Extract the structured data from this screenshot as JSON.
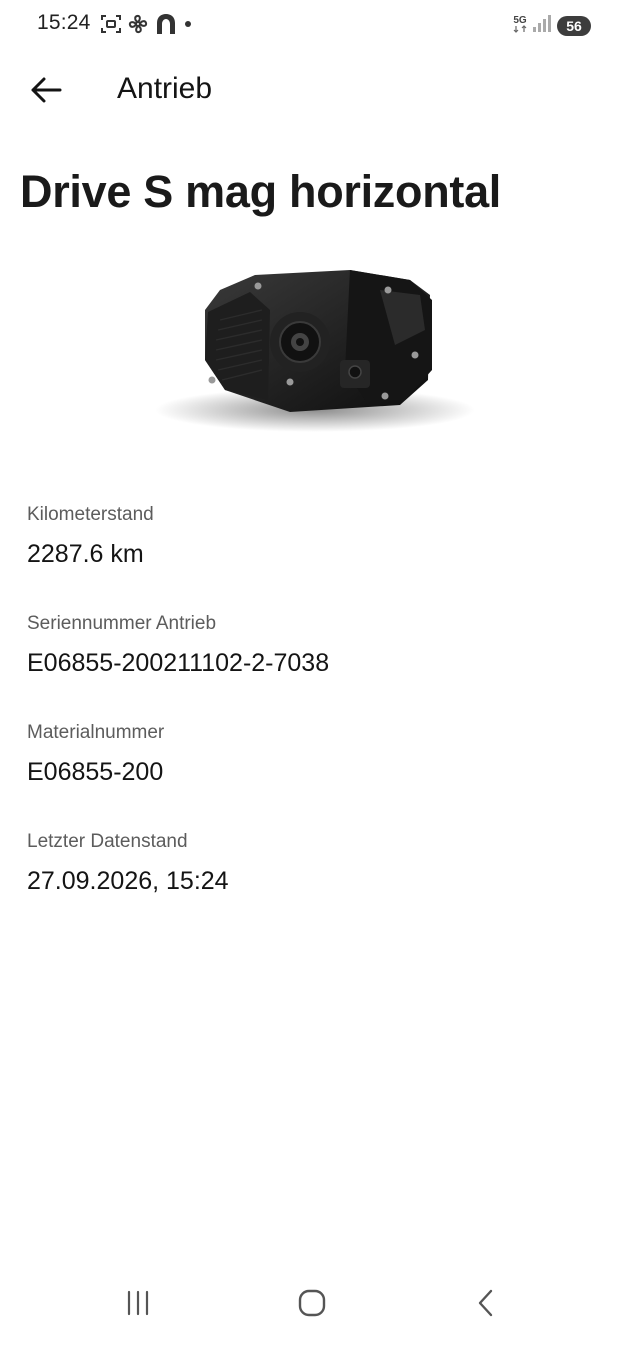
{
  "status_bar": {
    "time": "15:24",
    "network": "5G",
    "battery": "56",
    "left_icons": [
      "screenshot-icon",
      "fan-icon",
      "home-app-icon",
      "dot-icon"
    ],
    "right_icons": [
      "5g-icon",
      "signal-icon",
      "battery-icon"
    ]
  },
  "header": {
    "back_icon": "back-arrow-icon",
    "title": "Antrieb"
  },
  "page_title": "Drive S mag horizontal",
  "product_image": "drive-motor-image",
  "details": [
    {
      "label": "Kilometerstand",
      "value": "2287.6 km"
    },
    {
      "label": "Seriennummer Antrieb",
      "value": "E06855-200211102-2-7038"
    },
    {
      "label": "Materialnummer",
      "value": "E06855-200"
    },
    {
      "label": "Letzter Datenstand",
      "value": "27.09.2026, 15:24"
    }
  ],
  "nav_bar": {
    "recents_icon": "recents-icon",
    "home_icon": "home-circle-icon",
    "back_icon": "nav-back-icon"
  }
}
